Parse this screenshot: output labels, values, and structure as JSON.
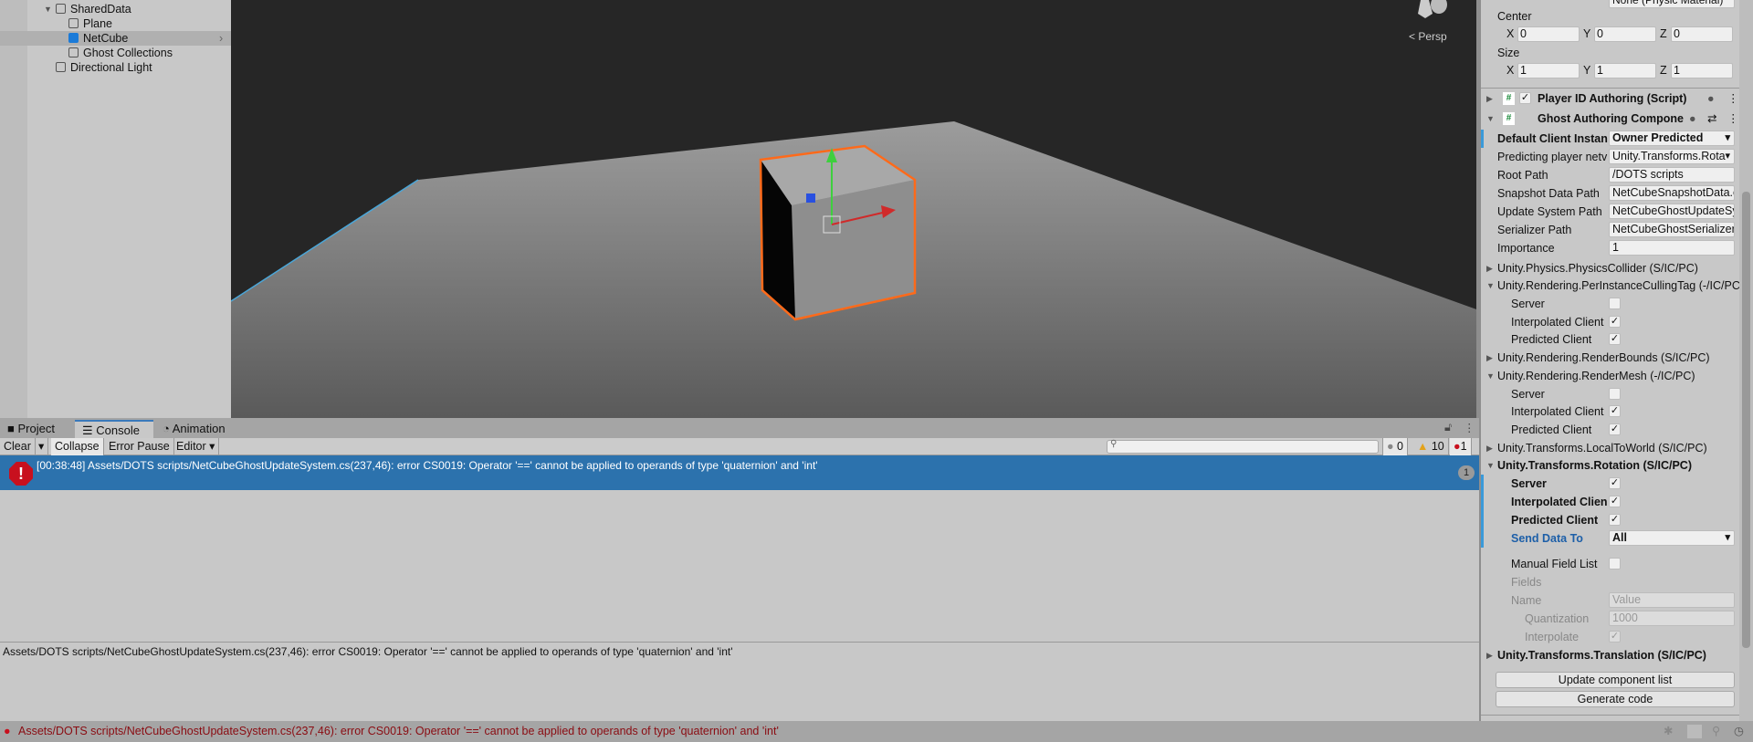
{
  "hierarchy": {
    "items": [
      {
        "label": "SharedData"
      },
      {
        "label": "Plane"
      },
      {
        "label": "NetCube"
      },
      {
        "label": "Ghost Collections"
      },
      {
        "label": "Directional Light"
      }
    ]
  },
  "scene": {
    "projection": "Persp"
  },
  "console": {
    "tabs": [
      "Project",
      "Console",
      "Animation"
    ],
    "toolbar": {
      "clear": "Clear",
      "collapse": "Collapse",
      "error_pause": "Error Pause",
      "editor": "Editor"
    },
    "search_placeholder": "",
    "counts": {
      "info": "0",
      "warnings": "10",
      "errors": "1"
    },
    "entries": [
      {
        "text": "[00:38:48] Assets/DOTS scripts/NetCubeGhostUpdateSystem.cs(237,46): error CS0019: Operator '==' cannot be applied to operands of type 'quaternion' and 'int'",
        "count": "1"
      }
    ],
    "detail": "Assets/DOTS scripts/NetCubeGhostUpdateSystem.cs(237,46): error CS0019: Operator '==' cannot be applied to operands of type 'quaternion' and 'int'"
  },
  "status": {
    "message": "Assets/DOTS scripts/NetCubeGhostUpdateSystem.cs(237,46): error CS0019: Operator '==' cannot be applied to operands of type 'quaternion' and 'int'"
  },
  "inspector": {
    "material_value": "None (Physic Material)",
    "center_label": "Center",
    "center": {
      "x": "0",
      "y": "0",
      "z": "0"
    },
    "size_label": "Size",
    "size": {
      "x": "1",
      "y": "1",
      "z": "1"
    },
    "axis": {
      "x": "X",
      "y": "Y",
      "z": "Z"
    },
    "player_id": "Player ID Authoring (Script)",
    "ghost_auth": "Ghost Authoring Componer",
    "fields": [
      {
        "label": "Default Client Instan",
        "value": "Owner Predicted"
      },
      {
        "label": "Predicting player netv",
        "value": "Unity.Transforms.Rota"
      },
      {
        "label": "Root Path",
        "value": "/DOTS scripts"
      },
      {
        "label": "Snapshot Data Path",
        "value": "NetCubeSnapshotData.cs"
      },
      {
        "label": "Update System Path",
        "value": "NetCubeGhostUpdateSystem.cs"
      },
      {
        "label": "Serializer Path",
        "value": "NetCubeGhostSerializer.cs"
      },
      {
        "label": "Importance",
        "value": "1"
      }
    ],
    "components": {
      "physics_collider": "Unity.Physics.PhysicsCollider (S/IC/PC)",
      "culling_tag": "Unity.Rendering.PerInstanceCullingTag (-/IC/PC)",
      "render_bounds": "Unity.Rendering.RenderBounds (S/IC/PC)",
      "render_mesh": "Unity.Rendering.RenderMesh (-/IC/PC)",
      "local_to_world": "Unity.Transforms.LocalToWorld (S/IC/PC)",
      "rotation": "Unity.Transforms.Rotation (S/IC/PC)",
      "translation": "Unity.Transforms.Translation (S/IC/PC)"
    },
    "server": "Server",
    "interp": "Interpolated Client",
    "interp_short": "Interpolated Clien",
    "pred": "Predicted Client",
    "send_data_label": "Send Data To",
    "send_data_value": "All",
    "manual_field": "Manual Field List",
    "fields_label": "Fields",
    "name_label": "Name",
    "name_value": "Value",
    "quant_label": "Quantization",
    "quant_value": "1000",
    "interpolate_label": "Interpolate",
    "update_btn": "Update component list",
    "generate_btn": "Generate code"
  },
  "colors": {
    "accent": "#2c72ad",
    "error": "#c8101e"
  }
}
